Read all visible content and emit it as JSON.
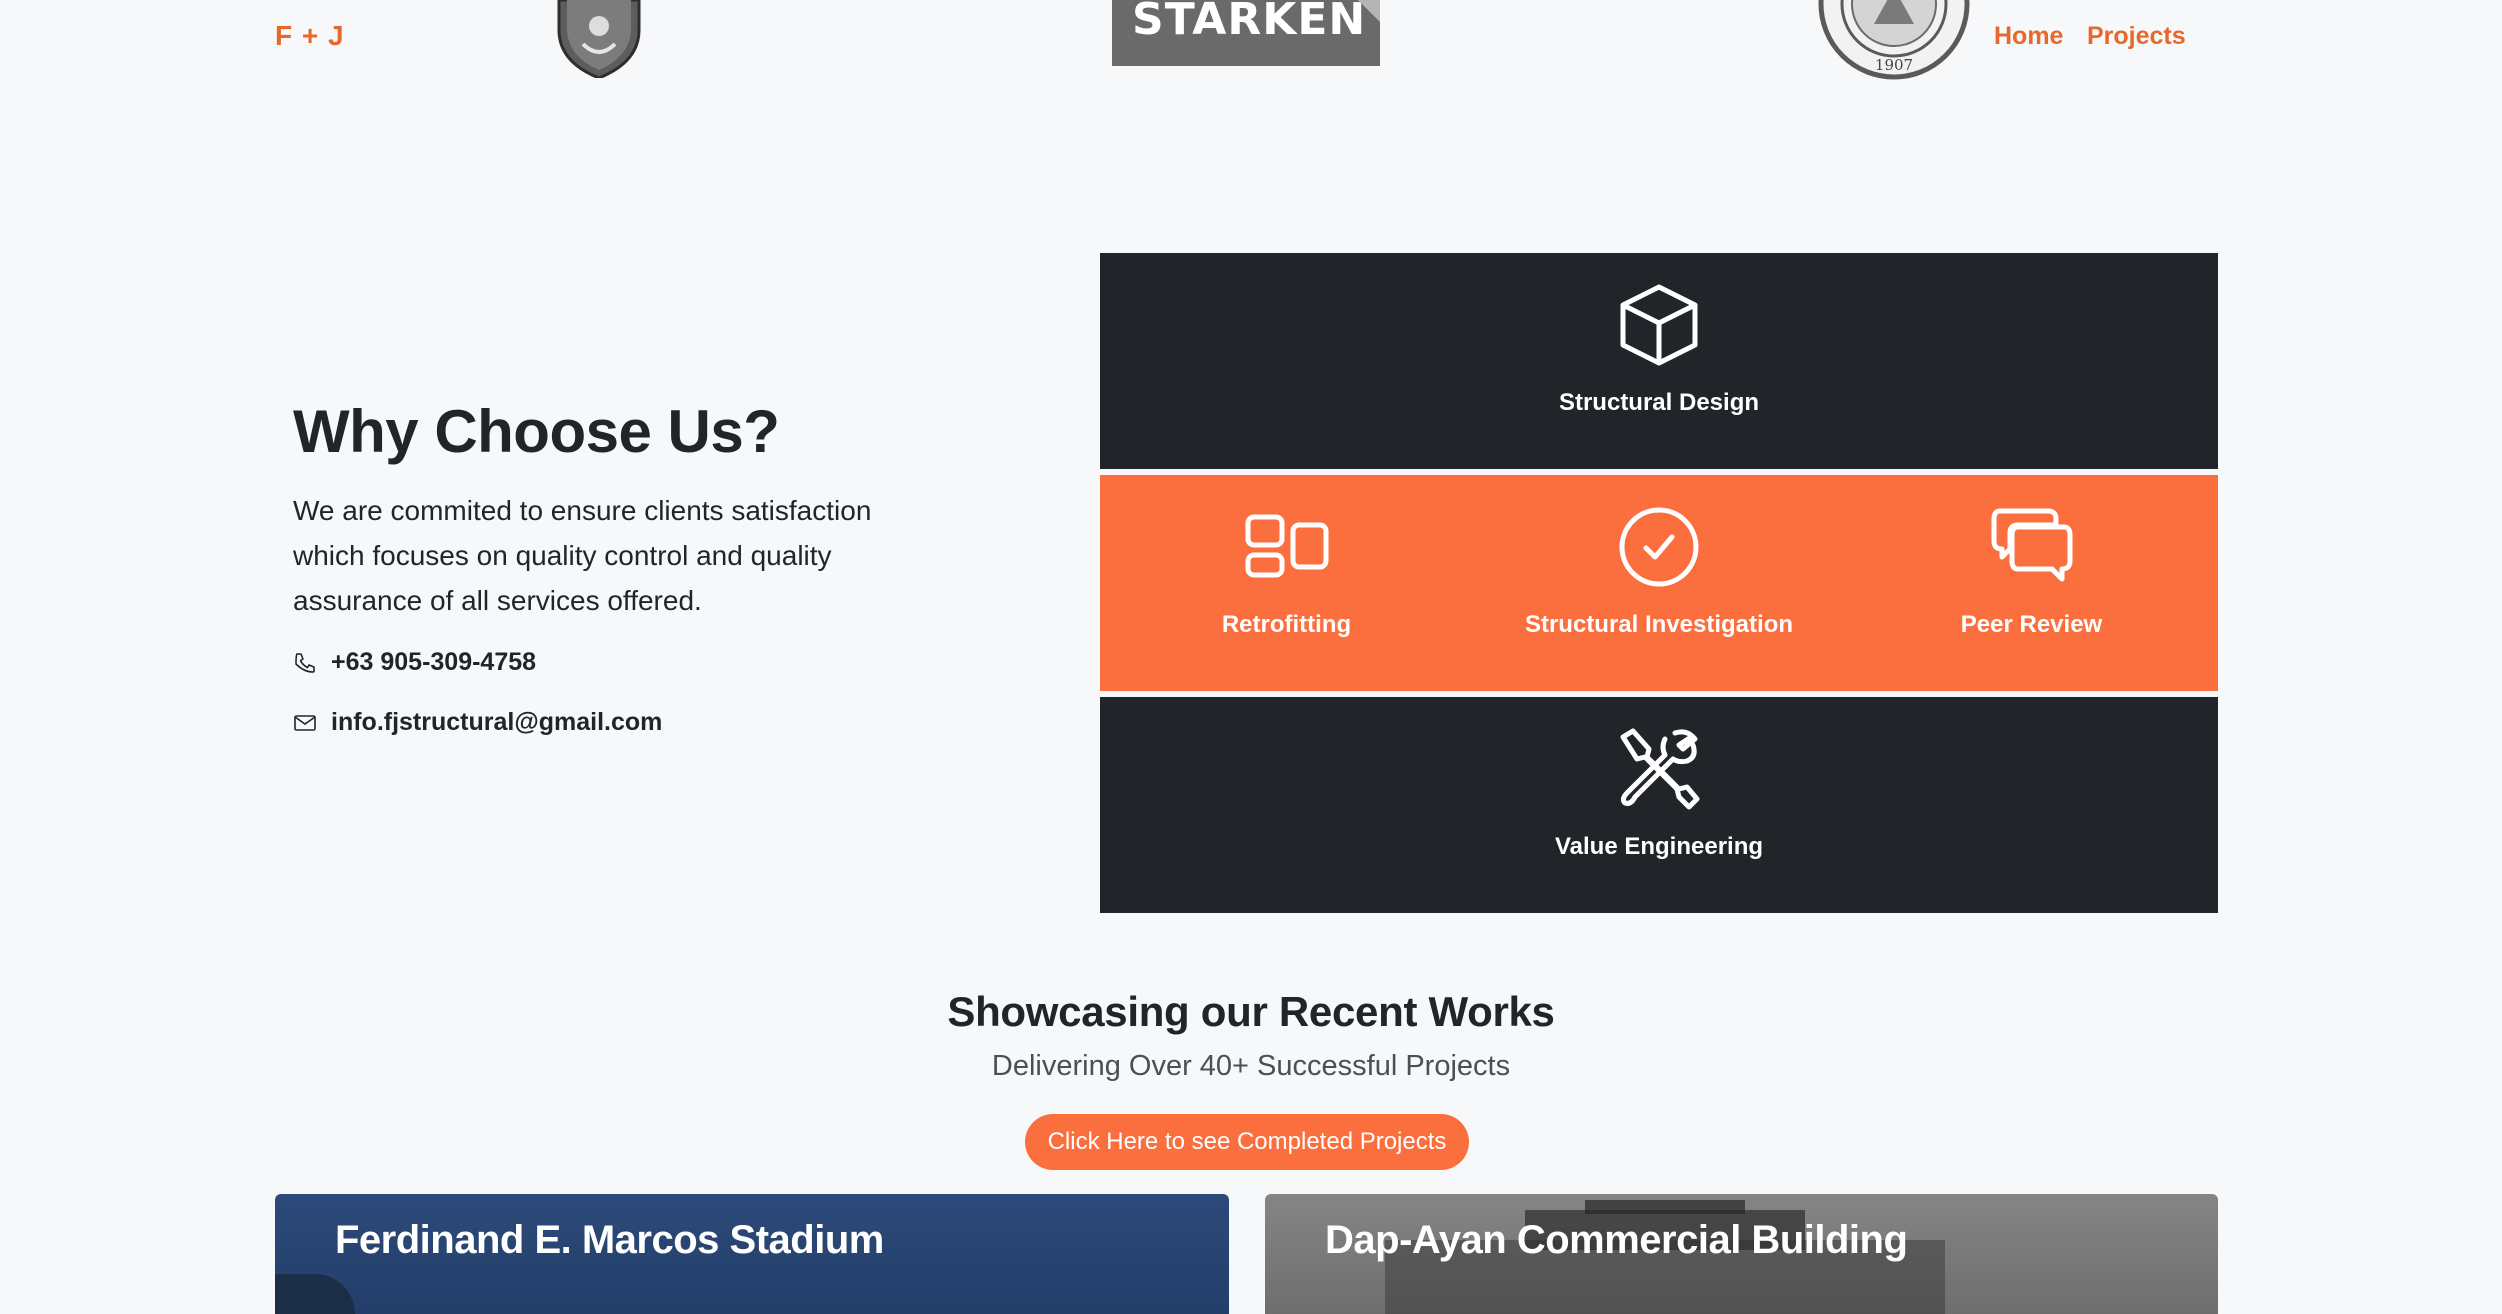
{
  "header": {
    "brand": "F + J",
    "logo_starken": "STÄRKEN",
    "seal_text": "1907",
    "nav": {
      "home": "Home",
      "projects": "Projects"
    }
  },
  "why": {
    "title": "Why Choose Us?",
    "description": "We are commited to ensure clients satisfaction which focuses on quality control and quality assurance of all services offered.",
    "phone": "+63 905-309-4758",
    "email": "info.fjstructural@gmail.com"
  },
  "services": {
    "structural_design": "Structural Design",
    "retrofitting": "Retrofitting",
    "structural_investigation": "Structural Investigation",
    "peer_review": "Peer Review",
    "value_engineering": "Value Engineering"
  },
  "showcase": {
    "title": "Showcasing our Recent Works",
    "subtitle": "Delivering Over 40+ Successful Projects",
    "cta": "Click Here to see Completed Projects",
    "cards": [
      {
        "title": "Ferdinand E. Marcos Stadium"
      },
      {
        "title": "Dap-Ayan Commercial Building"
      }
    ]
  },
  "colors": {
    "accent": "#e8672d",
    "orange_panel": "#fb6f3f",
    "dark_panel": "#212529",
    "background": "#f7f8fa"
  },
  "icons": [
    "box-icon",
    "layout-icon",
    "check-circle-icon",
    "chat-bubbles-icon",
    "tools-icon",
    "phone-icon",
    "envelope-icon"
  ]
}
